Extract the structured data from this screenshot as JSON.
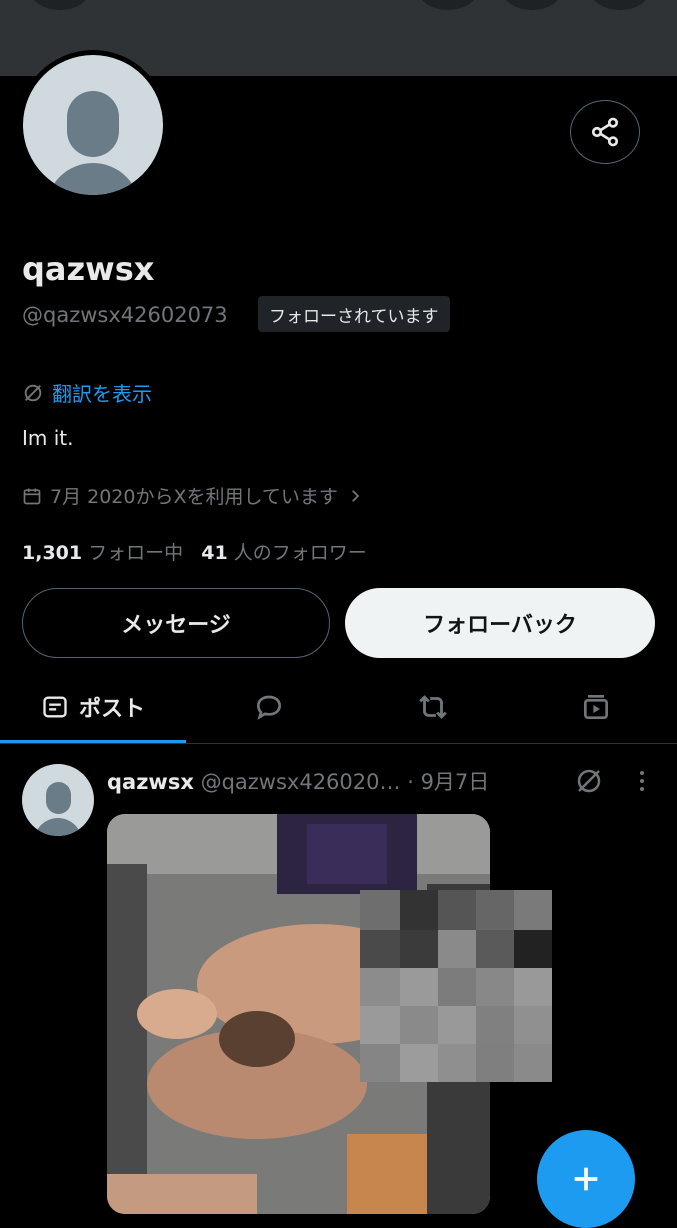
{
  "profile": {
    "name": "qazwsx",
    "handle": "@qazwsx42602073",
    "follows_you_badge": "フォローされています",
    "translate_label": "翻訳を表示",
    "bio": "Im it.",
    "joined": "7月 2020からXを利用しています",
    "following_count": "1,301",
    "following_label": "フォロー中",
    "followers_count": "41",
    "followers_label": "人のフォロワー"
  },
  "actions": {
    "message_label": "メッセージ",
    "follow_back_label": "フォローバック"
  },
  "tabs": {
    "posts_label": "ポスト"
  },
  "post": {
    "name": "qazwsx",
    "handle": "@qazwsx426020…",
    "separator": "·",
    "date": "9月7日"
  },
  "icons": {
    "share": "share-icon",
    "translate": "translate-icon",
    "calendar": "calendar-icon",
    "chevron": "chevron-right-icon",
    "posts_tab": "posts-tab-icon",
    "replies_tab": "replies-tab-icon",
    "reposts_tab": "reposts-tab-icon",
    "media_tab": "media-tab-icon",
    "more": "more-vertical-icon",
    "compose": "compose-plus-icon"
  },
  "colors": {
    "background": "#000000",
    "accent": "#1d9bf0",
    "secondary_text": "#71767b",
    "primary_text": "#e7e9ea",
    "follow_back_bg": "#eff3f4"
  }
}
